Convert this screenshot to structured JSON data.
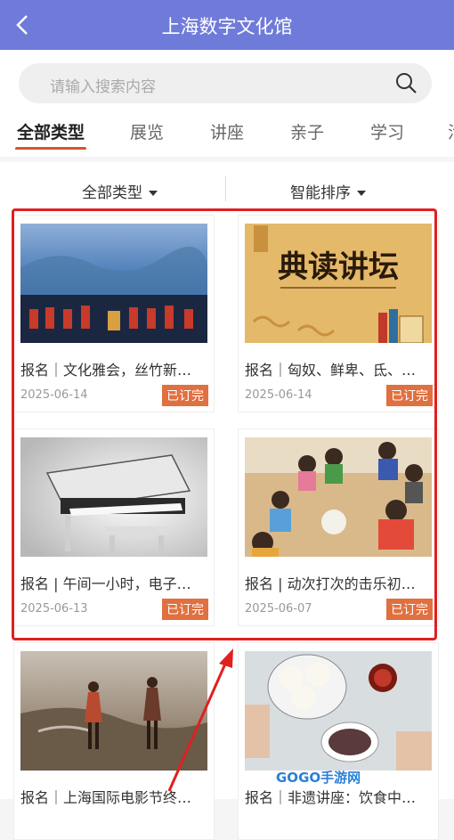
{
  "header": {
    "title": "上海数字文化馆"
  },
  "search": {
    "placeholder": "请输入搜索内容"
  },
  "tabs": [
    "全部类型",
    "展览",
    "讲座",
    "亲子",
    "学习",
    "活"
  ],
  "filters": {
    "type_label": "全部类型",
    "sort_label": "智能排序"
  },
  "cards": [
    {
      "title": "报名｜文化雅会，丝竹新…",
      "date": "2025-06-14",
      "status": "已订完",
      "image": "orchestra-by-lake"
    },
    {
      "title": "报名｜匈奴、鲜卑、氐、…",
      "date": "2025-06-14",
      "status": "已订完",
      "image": "classic-reading-forum-banner",
      "image_text": "典读讲坛"
    },
    {
      "title": "报名 | 午间一小时，电子…",
      "date": "2025-06-13",
      "status": "已订完",
      "image": "electronic-organ"
    },
    {
      "title": "报名 | 动次打次的击乐初…",
      "date": "2025-06-07",
      "status": "已订完",
      "image": "children-circle-activity"
    },
    {
      "title": "报名｜上海国际电影节终…",
      "date": "",
      "status": "",
      "image": "couple-on-beach"
    },
    {
      "title": "报名｜非遗讲座：饮食中…",
      "date": "",
      "status": "",
      "image": "steamed-buns-and-porridge"
    }
  ],
  "watermark": {
    "text": "GOGO手游网"
  },
  "colors": {
    "header": "#6f7bd9",
    "accent": "#d9542c",
    "badge": "#e07040",
    "highlight": "#e02020"
  }
}
